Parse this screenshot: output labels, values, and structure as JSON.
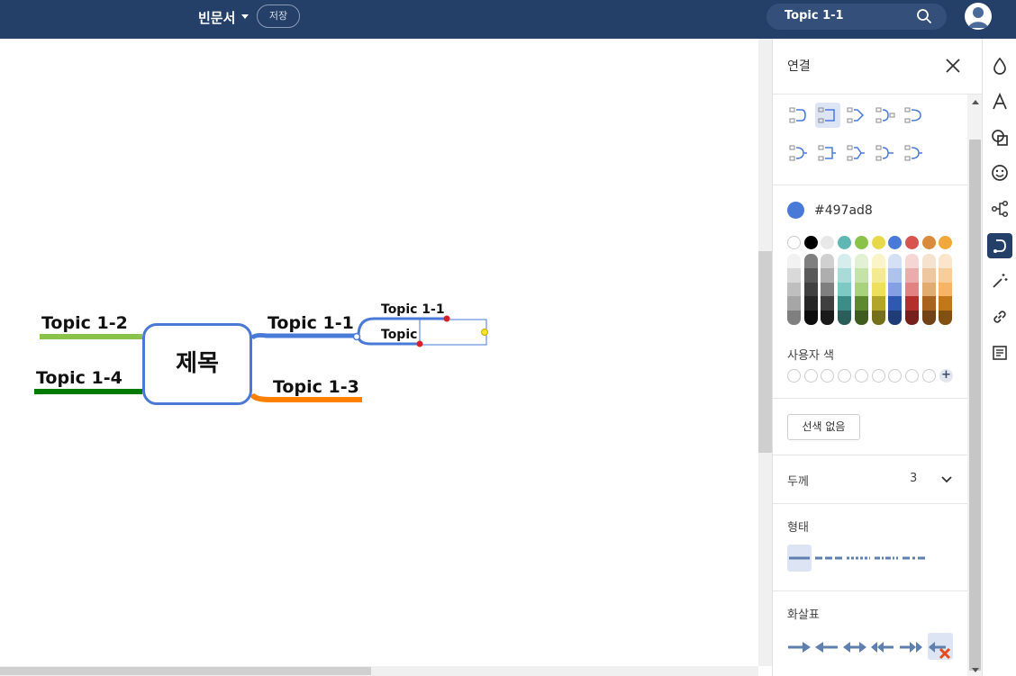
{
  "topbar": {
    "doc_title": "빈문서",
    "save_label": "저장",
    "search_value": "Topic 1-1"
  },
  "mindmap": {
    "central": "제목",
    "topics": [
      {
        "label": "Topic 1-1",
        "color": "#497ad8"
      },
      {
        "label": "Topic 1-2",
        "color": "#8bc34a"
      },
      {
        "label": "Topic 1-3",
        "color": "#ff7f00"
      },
      {
        "label": "Topic 1-4",
        "color": "#007a00"
      }
    ],
    "subtopics": [
      {
        "label": "Topic 1-1"
      },
      {
        "label": "Topic"
      }
    ]
  },
  "panel": {
    "title": "연결",
    "connector_styles": [
      "curve-elbow",
      "square-elbow",
      "angle",
      "curve-both",
      "round",
      "curve-elbow-out",
      "square-elbow-out",
      "angle-out",
      "curve-both-out",
      "round-out"
    ],
    "selected_connector": 1,
    "current_color": "#497ad8",
    "current_color_label": "#497ad8",
    "palette_top": [
      "#ffffff",
      "#000000",
      "#e8e8e8",
      "#5fb7b3",
      "#8bc34a",
      "#e8d94a",
      "#497ad8",
      "#d9534f",
      "#d98a3a",
      "#f0a83a"
    ],
    "palette_shades": [
      [
        "#f2f2f2",
        "#d9d9d9",
        "#bfbfbf",
        "#a6a6a6",
        "#7f7f7f"
      ],
      [
        "#7f7f7f",
        "#595959",
        "#404040",
        "#262626",
        "#0d0d0d"
      ],
      [
        "#d0d0d0",
        "#aeaeae",
        "#7f7f7f",
        "#3f3f3f",
        "#1a1a1a"
      ],
      [
        "#d5eeed",
        "#a9dcd9",
        "#7fc9c5",
        "#3d8c88",
        "#2a5e5b"
      ],
      [
        "#e2f0d3",
        "#c5e2a8",
        "#a8d27c",
        "#5d8a2e",
        "#3e5c1f"
      ],
      [
        "#faf4c8",
        "#f4ea92",
        "#eee05c",
        "#b3a52a",
        "#77701b"
      ],
      [
        "#d5e0f5",
        "#adc2ec",
        "#849fe2",
        "#2e59b0",
        "#1f3c76"
      ],
      [
        "#f5d6d5",
        "#ebadab",
        "#e18481",
        "#b3302c",
        "#771f1d"
      ],
      [
        "#f5e2cf",
        "#ecc79f",
        "#e2ab70",
        "#a9631f",
        "#714215"
      ],
      [
        "#fbe6cc",
        "#f8cd99",
        "#f5b466",
        "#c1781b",
        "#815012"
      ]
    ],
    "custom_color_label": "사용자 색",
    "custom_slots": 9,
    "no_line_label": "선색 없음",
    "thickness_label": "두께",
    "thickness_value": "3",
    "shape_label": "형태",
    "shape_options": [
      "solid",
      "dashed",
      "dotted",
      "dash-dot",
      "long-dash"
    ],
    "arrow_label": "화살표",
    "arrow_options": [
      "arrow-right",
      "arrow-left",
      "arrow-both",
      "double-arrow-left",
      "double-arrow-right",
      "no-arrow"
    ]
  },
  "toolbar": {
    "buttons": [
      "fill",
      "text",
      "shape",
      "emoji",
      "structure",
      "connection",
      "magic",
      "link",
      "note"
    ],
    "selected": "connection"
  }
}
